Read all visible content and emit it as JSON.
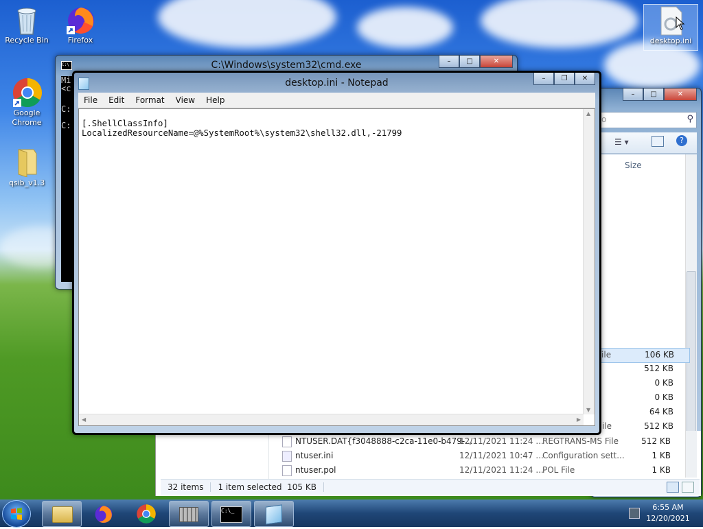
{
  "desktop": {
    "icons": [
      {
        "label": "Recycle Bin"
      },
      {
        "label": "Firefox"
      },
      {
        "label": "Google Chrome"
      },
      {
        "label": "qsib_v1.3"
      },
      {
        "label": "desktop.ini"
      }
    ]
  },
  "cmd": {
    "title": "C:\\Windows\\system32\\cmd.exe",
    "console_chars": [
      "Mi",
      "<c",
      "",
      "C:",
      "",
      "C:"
    ]
  },
  "notepad": {
    "title": "desktop.ini - Notepad",
    "menu": [
      "File",
      "Edit",
      "Format",
      "View",
      "Help"
    ],
    "content_line1": "[.ShellClassInfo]",
    "content_line2": "LocalizedResourceName=@%SystemRoot%\\system32\\shell32.dll,-21799"
  },
  "explorer": {
    "search_placeholder": "o",
    "column_size": "Size",
    "partial_rows": [
      {
        "type": "File",
        "size": "106 KB"
      },
      {
        "type": "",
        "size": "512 KB"
      },
      {
        "type": "",
        "size": "0 KB"
      },
      {
        "type": "",
        "size": "0 KB"
      },
      {
        "type": "",
        "size": "64 KB"
      },
      {
        "type": "ile",
        "size": "512 KB"
      }
    ],
    "rows": [
      {
        "name": "NTUSER.DAT{f3048888-c2ca-11e0-b479-...",
        "date": "12/11/2021 11:24 ...",
        "type": "REGTRANS-MS File",
        "size": "512 KB"
      },
      {
        "name": "ntuser.ini",
        "date": "12/11/2021 10:47 ...",
        "type": "Configuration sett...",
        "size": "1 KB"
      },
      {
        "name": "ntuser.pol",
        "date": "12/11/2021 11:24 ...",
        "type": "POL File",
        "size": "1 KB"
      }
    ],
    "status_items": "32 items",
    "status_selected": "1 item selected  105 KB"
  },
  "taskbar": {
    "time": "6:55 AM",
    "date": "12/20/2021"
  },
  "colors": {
    "taskbar": "#1f4677",
    "window_frame": "#8fb0d3",
    "close_button": "#c9463a"
  }
}
